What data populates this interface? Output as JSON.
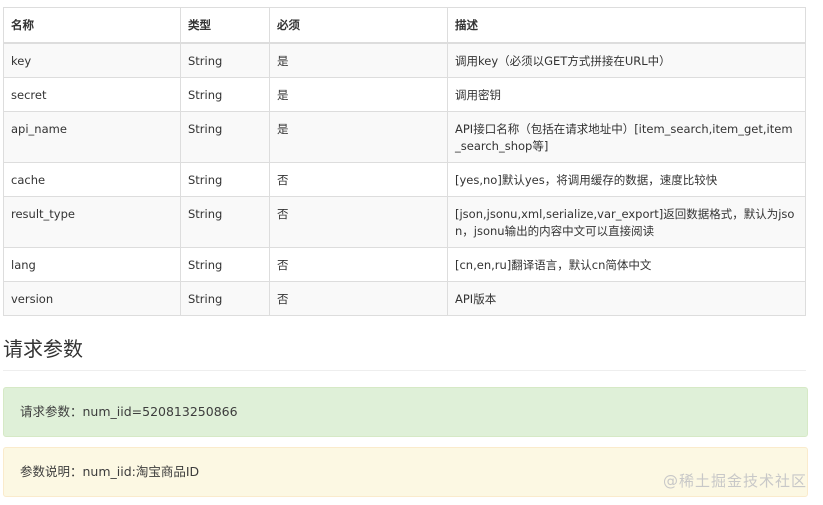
{
  "table": {
    "headers": [
      "名称",
      "类型",
      "必须",
      "描述"
    ],
    "rows": [
      {
        "name": "key",
        "type": "String",
        "required": "是",
        "desc": "调用key（必须以GET方式拼接在URL中）"
      },
      {
        "name": "secret",
        "type": "String",
        "required": "是",
        "desc": "调用密钥"
      },
      {
        "name": "api_name",
        "type": "String",
        "required": "是",
        "desc": "API接口名称（包括在请求地址中）[item_search,item_get,item_search_shop等]"
      },
      {
        "name": "cache",
        "type": "String",
        "required": "否",
        "desc": "[yes,no]默认yes，将调用缓存的数据，速度比较快"
      },
      {
        "name": "result_type",
        "type": "String",
        "required": "否",
        "desc": "[json,jsonu,xml,serialize,var_export]返回数据格式，默认为json，jsonu输出的内容中文可以直接阅读"
      },
      {
        "name": "lang",
        "type": "String",
        "required": "否",
        "desc": "[cn,en,ru]翻译语言，默认cn简体中文"
      },
      {
        "name": "version",
        "type": "String",
        "required": "否",
        "desc": "API版本"
      }
    ]
  },
  "section_title": "请求参数",
  "request_params": "请求参数：num_iid=520813250866",
  "params_note": "参数说明：num_iid:淘宝商品ID",
  "watermark": "@稀土掘金技术社区"
}
